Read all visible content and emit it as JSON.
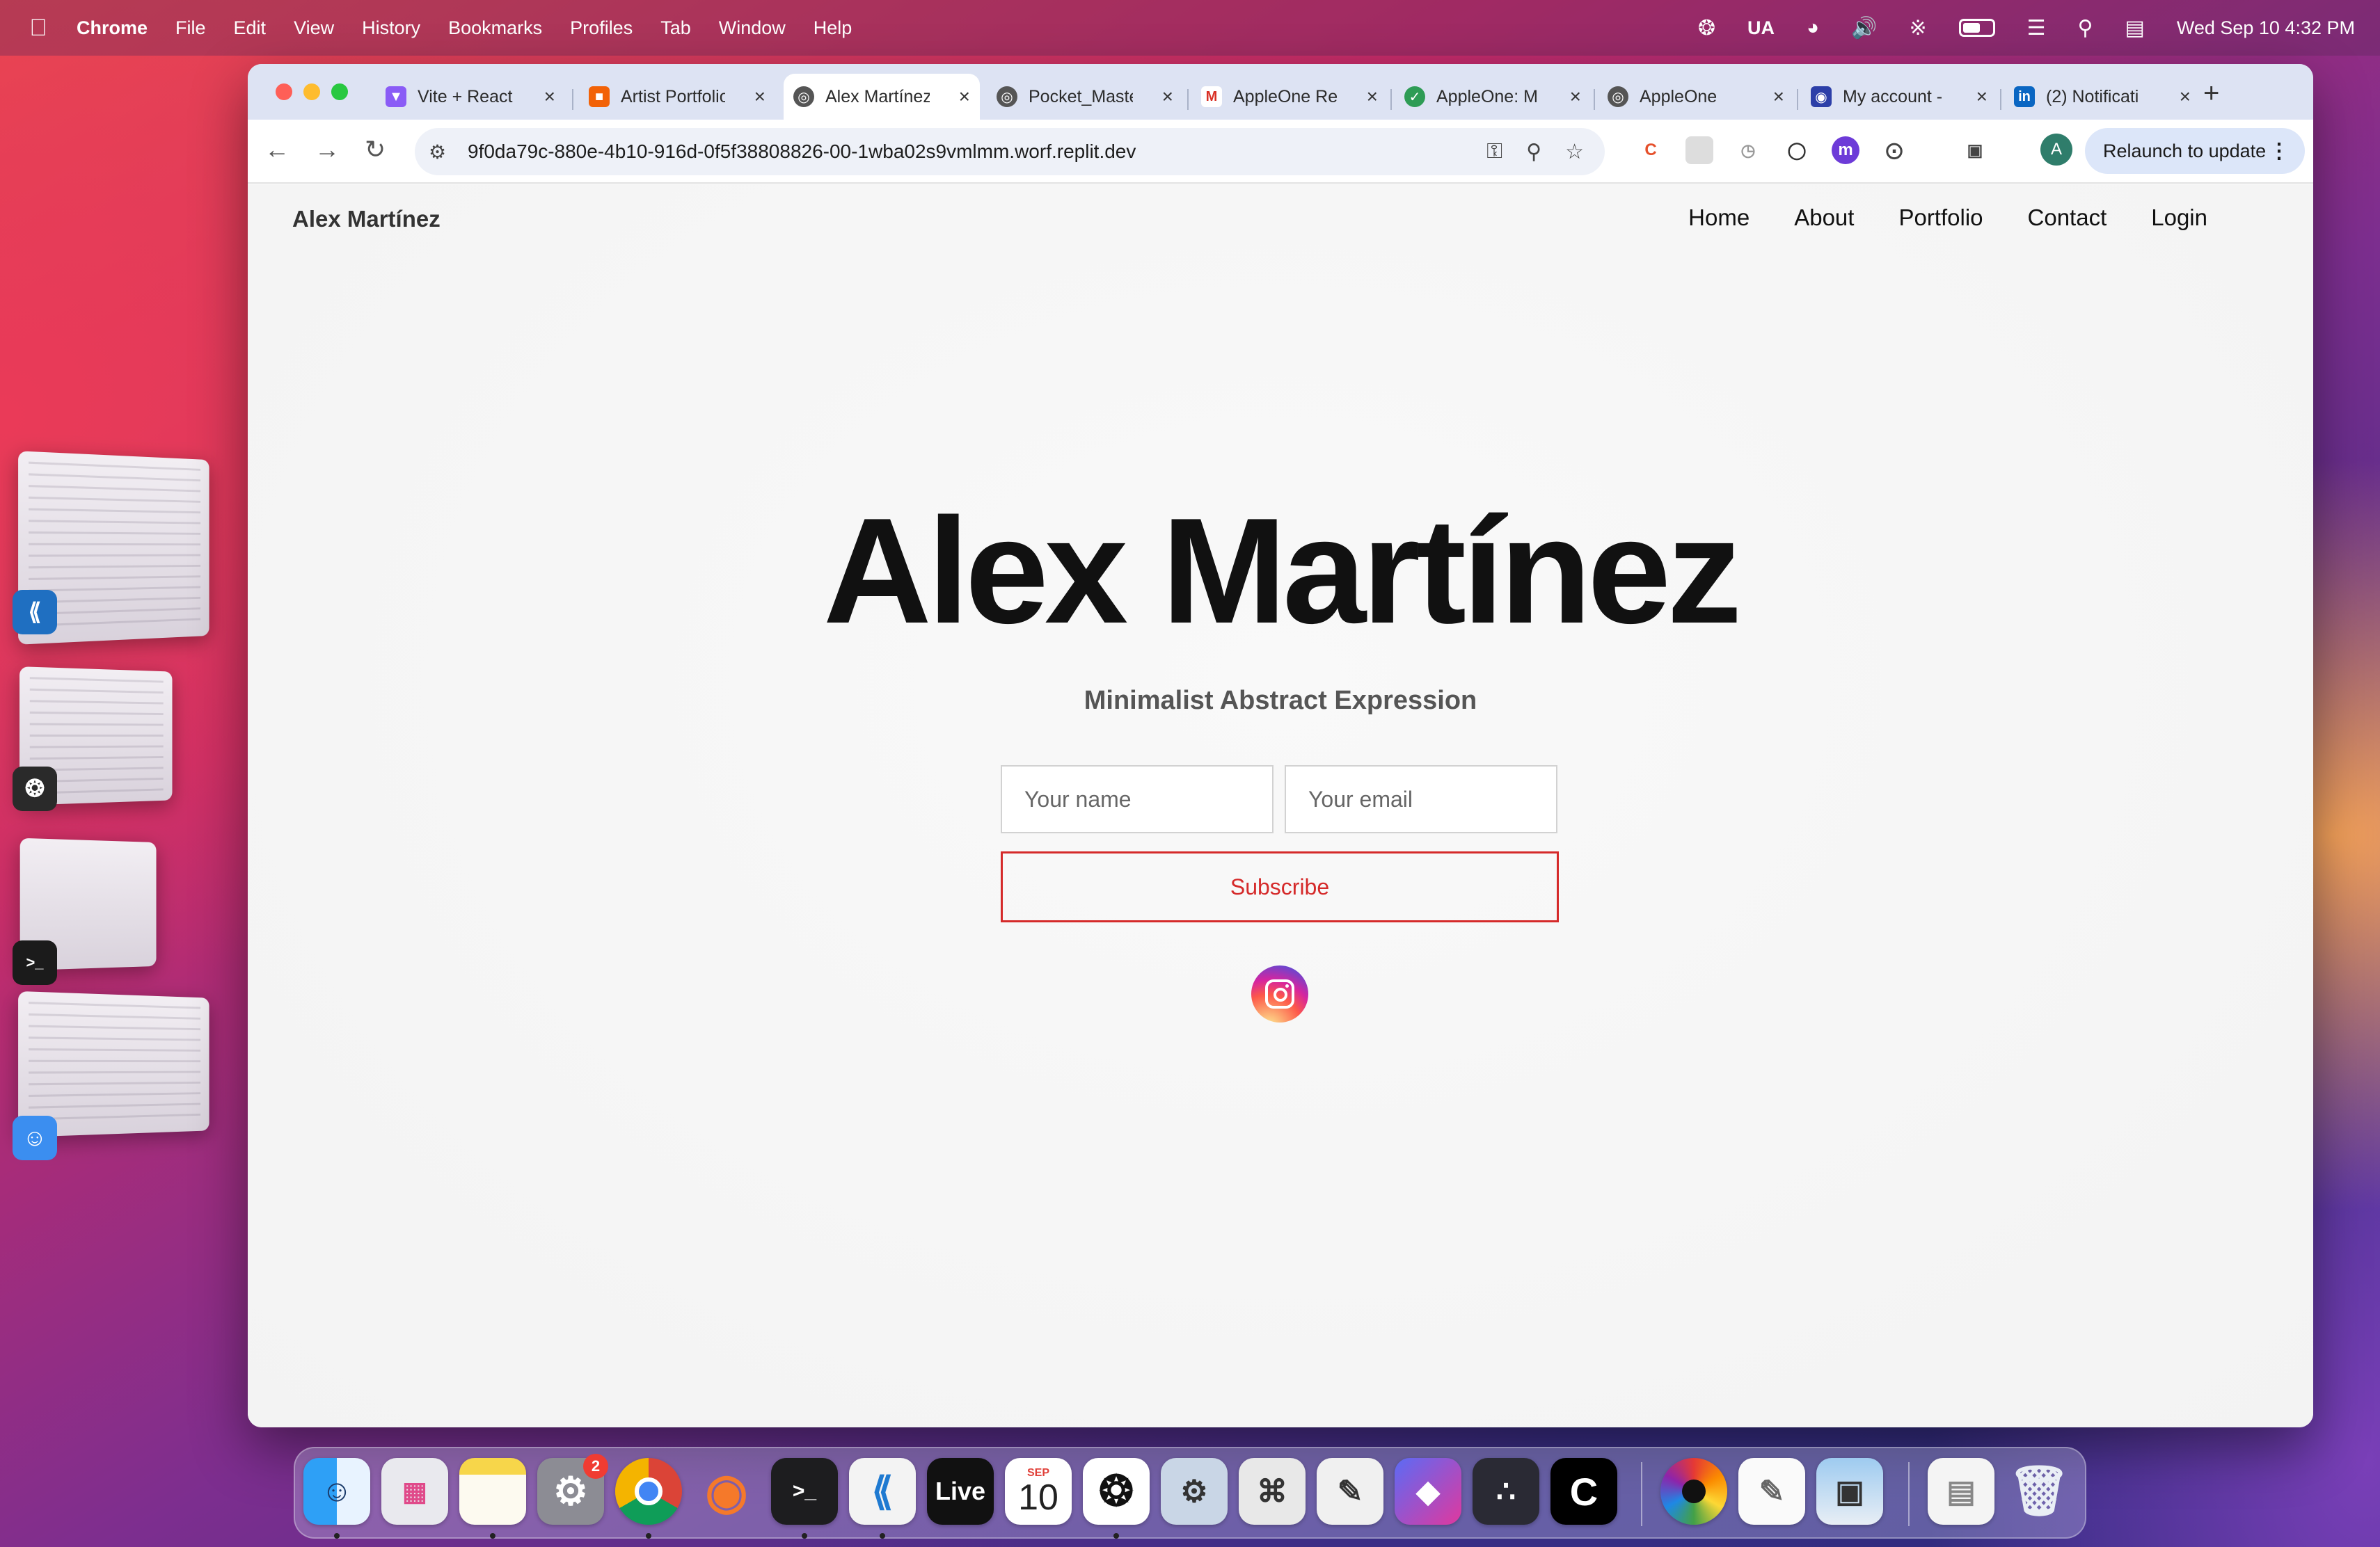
{
  "menubar": {
    "app": "Chrome",
    "items": [
      "File",
      "Edit",
      "View",
      "History",
      "Bookmarks",
      "Profiles",
      "Tab",
      "Window",
      "Help"
    ],
    "input_source": "UA",
    "datetime": "Wed Sep 10  4:32 PM"
  },
  "browser": {
    "tabs": [
      {
        "title": "Vite + React",
        "icon": "vite-icon"
      },
      {
        "title": "Artist Portfolio",
        "icon": "replit-icon"
      },
      {
        "title": "Alex Martínez",
        "icon": "globe-icon",
        "active": true
      },
      {
        "title": "Pocket_Master",
        "icon": "globe-icon"
      },
      {
        "title": "AppleOne Re",
        "icon": "gmail-icon"
      },
      {
        "title": "AppleOne: M",
        "icon": "check-icon"
      },
      {
        "title": "AppleOne",
        "icon": "globe-icon"
      },
      {
        "title": "My account -",
        "icon": "account-icon"
      },
      {
        "title": "(2) Notificati",
        "icon": "linkedin-icon"
      }
    ],
    "url": "9f0da79c-880e-4b10-916d-0f5f38808826-00-1wba02s9vmlmm.worf.replit.dev",
    "profile_initial": "A",
    "relaunch_label": "Relaunch to update"
  },
  "site": {
    "logo": "Alex Martínez",
    "nav": [
      "Home",
      "About",
      "Portfolio",
      "Contact",
      "Login"
    ],
    "hero_title": "Alex Martínez",
    "hero_subtitle": "Minimalist Abstract Expression",
    "name_placeholder": "Your name",
    "email_placeholder": "Your email",
    "subscribe_label": "Subscribe"
  },
  "dock": {
    "calendar_month": "SEP",
    "calendar_day": "10",
    "settings_badge": "2",
    "live_label": "Live"
  },
  "colors": {
    "accent_red": "#d52a2a",
    "tabstrip": "#dde3f3"
  }
}
